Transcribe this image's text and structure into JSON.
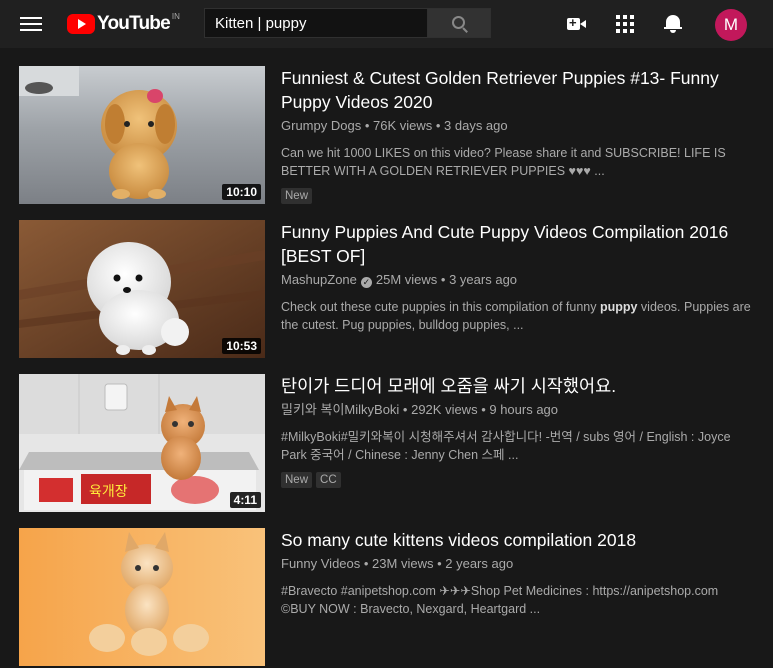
{
  "header": {
    "logo_text": "YouTube",
    "region": "IN",
    "search_value": "Kitten | puppy",
    "avatar_initial": "M"
  },
  "results": [
    {
      "title": "Funniest & Cutest Golden Retriever Puppies #13- Funny Puppy Videos 2020",
      "channel": "Grumpy Dogs",
      "views": "76K views",
      "age": "3 days ago",
      "description": "Can we hit 1000 LIKES on this video? Please share it and SUBSCRIBE! LIFE IS BETTER WITH A GOLDEN RETRIEVER PUPPIES ♥♥♥ ...",
      "duration": "10:10",
      "badges": [
        "New"
      ]
    },
    {
      "title": "Funny Puppies And Cute Puppy Videos Compilation 2016 [BEST OF]",
      "channel": "MashupZone",
      "verified": true,
      "views": "25M views",
      "age": "3 years ago",
      "description_before": "Check out these cute puppies in this compilation of funny ",
      "description_bold": "puppy",
      "description_after": " videos. Puppies are the cutest. Pug puppies, bulldog puppies, ...",
      "duration": "10:53"
    },
    {
      "title": "탄이가 드디어 모래에 오줌을 싸기 시작했어요.",
      "channel": "밀키와 복이MilkyBoki",
      "views": "292K views",
      "age": "9 hours ago",
      "description": "#MilkyBoki#밀키와복이 시청해주셔서 감사합니다! -번역 / subs 영어 / English : Joyce Park 중국어 / Chinese : Jenny Chen 스페 ...",
      "duration": "4:11",
      "badges": [
        "New",
        "CC"
      ]
    },
    {
      "title": "So many cute kittens videos compilation 2018",
      "channel": "Funny Videos",
      "views": "23M views",
      "age": "2 years ago",
      "description": "#Bravecto #anipetshop.com ✈✈✈Shop Pet Medicines : https://anipetshop.com ©BUY NOW : Bravecto, Nexgard, Heartgard ..."
    }
  ],
  "separator": " • "
}
